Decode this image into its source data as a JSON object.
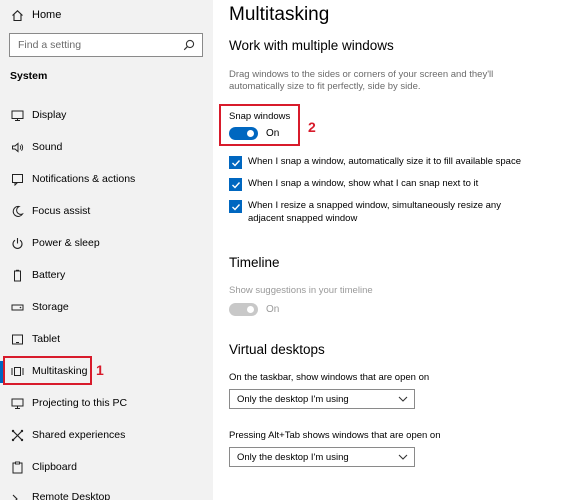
{
  "sidebar": {
    "home_label": "Home",
    "search_placeholder": "Find a setting",
    "section_label": "System",
    "items": [
      {
        "label": "Display",
        "icon": "display-icon"
      },
      {
        "label": "Sound",
        "icon": "speaker-icon"
      },
      {
        "label": "Notifications & actions",
        "icon": "notification-icon"
      },
      {
        "label": "Focus assist",
        "icon": "moon-icon"
      },
      {
        "label": "Power & sleep",
        "icon": "power-icon"
      },
      {
        "label": "Battery",
        "icon": "battery-icon"
      },
      {
        "label": "Storage",
        "icon": "storage-icon"
      },
      {
        "label": "Tablet",
        "icon": "tablet-icon"
      },
      {
        "label": "Multitasking",
        "icon": "multitasking-icon"
      },
      {
        "label": "Projecting to this PC",
        "icon": "projector-icon"
      },
      {
        "label": "Shared experiences",
        "icon": "shared-icon"
      },
      {
        "label": "Clipboard",
        "icon": "clipboard-icon"
      },
      {
        "label": "Remote Desktop",
        "icon": "remote-icon"
      }
    ],
    "active_item": "Multitasking",
    "callout_number": "1"
  },
  "main": {
    "title": "Multitasking",
    "snap": {
      "heading": "Work with multiple windows",
      "description": "Drag windows to the sides or corners of your screen and they'll automatically size to fit perfectly, side by side.",
      "toggle_label": "Snap windows",
      "toggle_state": "On",
      "toggle_on": true,
      "callout_number": "2",
      "options": [
        {
          "label": "When I snap a window, automatically size it to fill available space",
          "checked": true
        },
        {
          "label": "When I snap a window, show what I can snap next to it",
          "checked": true
        },
        {
          "label": "When I resize a snapped window, simultaneously resize any adjacent snapped window",
          "checked": true
        }
      ]
    },
    "timeline": {
      "heading": "Timeline",
      "toggle_label": "Show suggestions in your timeline",
      "toggle_state": "On",
      "toggle_on": true,
      "disabled": true
    },
    "virtual_desktops": {
      "heading": "Virtual desktops",
      "taskbar_label": "On the taskbar, show windows that are open on",
      "taskbar_value": "Only the desktop I'm using",
      "alttab_label": "Pressing Alt+Tab shows windows that are open on",
      "alttab_value": "Only the desktop I'm using"
    }
  },
  "colors": {
    "accent": "#0067c0",
    "callout": "#d81b2b",
    "sidebar_bg": "#f2f2f2",
    "muted_text": "#6b6b6b",
    "disabled_toggle": "#c8c8c8"
  }
}
